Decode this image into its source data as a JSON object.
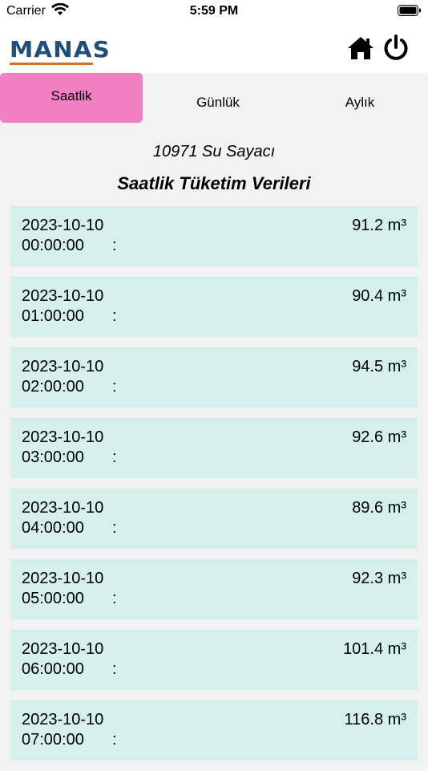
{
  "status_bar": {
    "carrier": "Carrier",
    "time": "5:59 PM"
  },
  "header": {
    "logo_text": "MANAS",
    "logo_colors": {
      "text": "#1f4e79",
      "bar": "#e06a1e"
    },
    "home_icon": "home-icon",
    "power_icon": "power-icon"
  },
  "tabs": [
    {
      "label": "Saatlik",
      "active": true
    },
    {
      "label": "Günlük",
      "active": false
    },
    {
      "label": "Aylık",
      "active": false
    }
  ],
  "accent_color": "#f07fc4",
  "row_color": "#d5efed",
  "meter_title": "10971 Su Sayacı",
  "section_title": "Saatlik Tüketim Verileri",
  "readings": [
    {
      "date": "2023-10-10",
      "hour": "00:00:00",
      "sep": ":",
      "value": "91.2 m³"
    },
    {
      "date": "2023-10-10",
      "hour": "01:00:00",
      "sep": ":",
      "value": "90.4 m³"
    },
    {
      "date": "2023-10-10",
      "hour": "02:00:00",
      "sep": ":",
      "value": "94.5 m³"
    },
    {
      "date": "2023-10-10",
      "hour": "03:00:00",
      "sep": ":",
      "value": "92.6 m³"
    },
    {
      "date": "2023-10-10",
      "hour": "04:00:00",
      "sep": ":",
      "value": "89.6 m³"
    },
    {
      "date": "2023-10-10",
      "hour": "05:00:00",
      "sep": ":",
      "value": "92.3 m³"
    },
    {
      "date": "2023-10-10",
      "hour": "06:00:00",
      "sep": ":",
      "value": "101.4 m³"
    },
    {
      "date": "2023-10-10",
      "hour": "07:00:00",
      "sep": ":",
      "value": "116.8 m³"
    }
  ]
}
